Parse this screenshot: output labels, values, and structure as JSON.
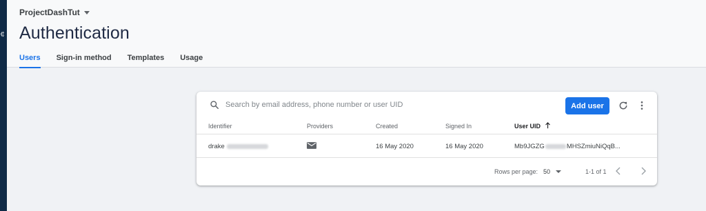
{
  "project": {
    "name": "ProjectDashTut"
  },
  "page": {
    "title": "Authentication"
  },
  "tabs": [
    {
      "label": "Users",
      "active": true
    },
    {
      "label": "Sign-in method",
      "active": false
    },
    {
      "label": "Templates",
      "active": false
    },
    {
      "label": "Usage",
      "active": false
    }
  ],
  "toolbar": {
    "search_placeholder": "Search by email address, phone number or user UID",
    "add_user_label": "Add user",
    "search_icon": "search-icon",
    "refresh_icon": "refresh-icon",
    "more_icon": "more-vert-icon"
  },
  "table": {
    "columns": [
      "Identifier",
      "Providers",
      "Created",
      "Signed In",
      "User UID"
    ],
    "sorted_column": "User UID",
    "sort_direction": "ascending",
    "rows": [
      {
        "identifier_prefix": "drake",
        "provider_icon": "email-icon",
        "created": "16 May 2020",
        "signed_in": "16 May 2020",
        "uid_prefix": "Mb9JGZG",
        "uid_suffix": "MHSZmiuNiQqB..."
      }
    ]
  },
  "pagination": {
    "rows_per_page_label": "Rows per page:",
    "rows_per_page_value": "50",
    "range_label": "1-1 of 1"
  },
  "colors": {
    "accent": "#1a73e8",
    "left_rail": "#0f2a46",
    "page_background": "#f0f2f5"
  }
}
